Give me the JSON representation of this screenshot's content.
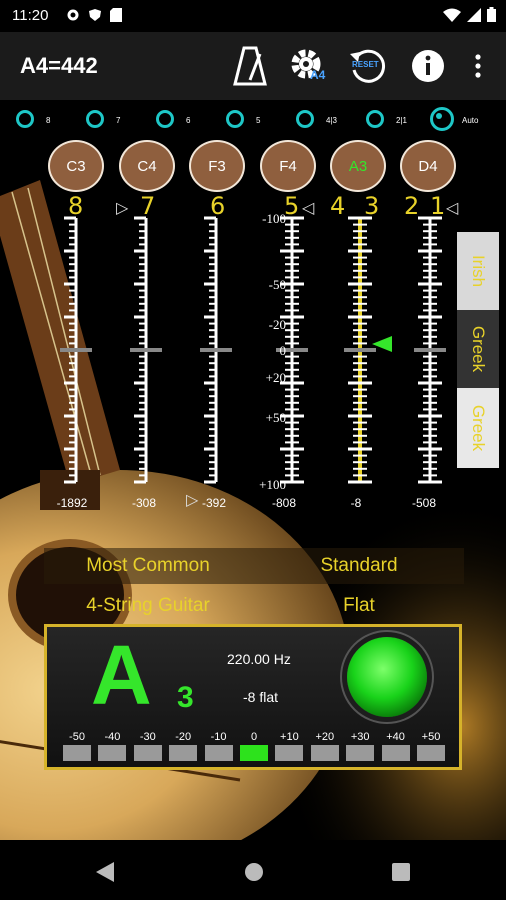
{
  "status": {
    "time": "11:20"
  },
  "app": {
    "title": "A4=442",
    "reset_label": "RESET",
    "a4_badge": "A4"
  },
  "strings_radio": [
    {
      "label": "8",
      "selected": false
    },
    {
      "label": "7",
      "selected": false
    },
    {
      "label": "6",
      "selected": false
    },
    {
      "label": "5",
      "selected": false
    },
    {
      "label": "4|3",
      "selected": false
    },
    {
      "label": "2|1",
      "selected": false
    },
    {
      "label": "Auto",
      "selected": true
    }
  ],
  "notes": [
    {
      "label": "C3",
      "active": false
    },
    {
      "label": "C4",
      "active": false
    },
    {
      "label": "F3",
      "active": false
    },
    {
      "label": "F4",
      "active": false
    },
    {
      "label": "A3",
      "active": true
    },
    {
      "label": "D4",
      "active": false
    }
  ],
  "string_numbers": [
    "8",
    "7",
    "6",
    "5",
    "4",
    "3",
    "2",
    "1"
  ],
  "scale_labels": [
    "-100",
    "-50",
    "-20",
    "0",
    "+20",
    "+50",
    "+100"
  ],
  "cents_labels": [
    "-1892",
    "-308",
    "-392",
    "-808",
    "-8",
    "-508"
  ],
  "side_tabs": [
    "Irish",
    "Greek",
    "Greek"
  ],
  "tuning": {
    "row1_left": "Most Common",
    "row1_right": "Standard",
    "row2_left": "4-String Guitar",
    "row2_right": "Flat"
  },
  "readout": {
    "note": "A",
    "octave": "3",
    "frequency": "220.00 Hz",
    "deviation": "-8 flat",
    "meter_labels": [
      "-50",
      "-40",
      "-30",
      "-20",
      "-10",
      "0",
      "+10",
      "+20",
      "+30",
      "+40",
      "+50"
    ],
    "meter_active_index": 5,
    "indicator_color": "#2de21c"
  },
  "colors": {
    "accent": "#1ec7c7",
    "highlight": "#e8d22a",
    "in_tune": "#35e62b",
    "note_button": "#8f5f3e"
  }
}
